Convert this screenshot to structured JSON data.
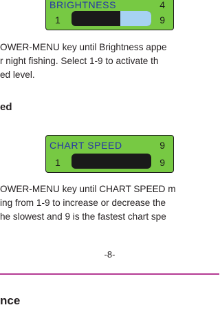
{
  "brightness_panel": {
    "label": "BRIGHTNESS",
    "value": "4",
    "scale_min": "1",
    "scale_max": "9",
    "level": 4,
    "fill_color": "#a6d2f2"
  },
  "brightness_text": {
    "lines": [
      "OWER-MENU key until Brightness appe",
      "r night fishing. Select 1-9 to activate th",
      "ed level."
    ]
  },
  "chart_speed_section": {
    "heading": "ed"
  },
  "chart_speed_panel": {
    "label": "CHART  SPEED",
    "value": "9",
    "scale_min": "1",
    "scale_max": "9",
    "level": 9
  },
  "chart_speed_text": {
    "lines": [
      "OWER-MENU key until CHART SPEED m",
      "ing from 1-9  to  increase or decrease the",
      "he slowest and 9 is the fastest chart spe"
    ]
  },
  "footer": {
    "page_number": "-8-",
    "rule_color": "#b43a93"
  },
  "next_section": {
    "heading": "nce"
  },
  "colors": {
    "lcd_background": "#77c943",
    "lcd_label": "#2433a8"
  }
}
